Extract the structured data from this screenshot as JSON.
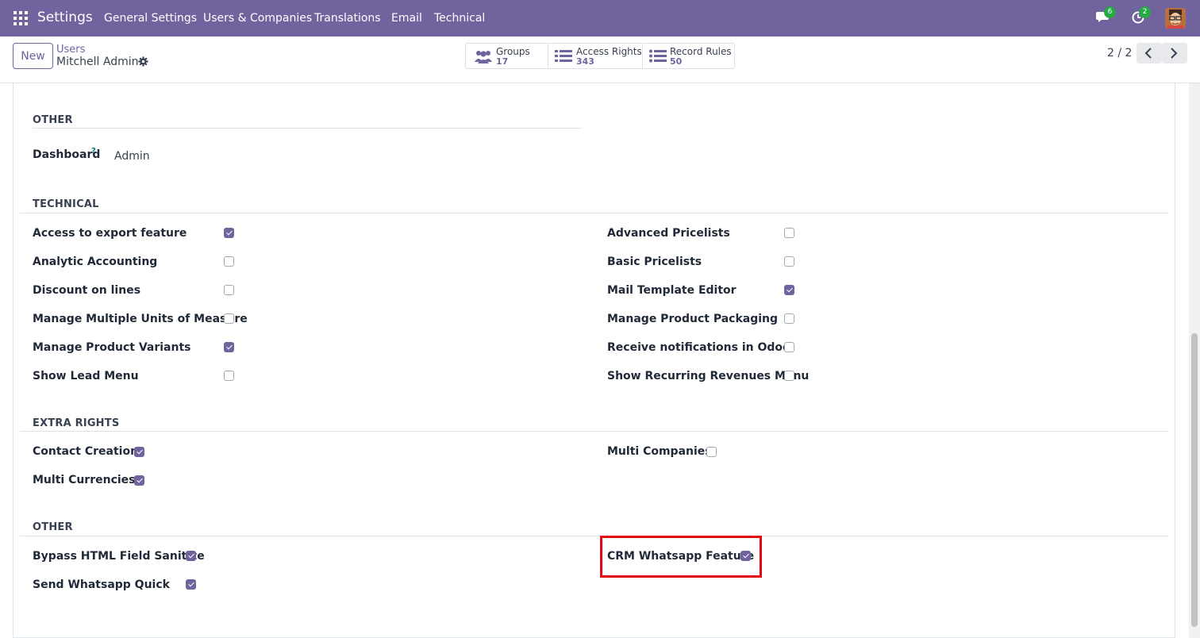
{
  "navbar": {
    "app_name": "Settings",
    "menu": [
      "General Settings",
      "Users & Companies",
      "Translations",
      "Email",
      "Technical"
    ],
    "messages_count": "6",
    "activities_count": "2",
    "bg_color": "#71639e"
  },
  "control_panel": {
    "new_label": "New",
    "breadcrumb": "Users",
    "record_name": "Mitchell Admin",
    "stats": [
      {
        "label": "Groups",
        "value": "17",
        "icon": "users-icon"
      },
      {
        "label": "Access Rights",
        "value": "343",
        "icon": "list-icon"
      },
      {
        "label": "Record Rules",
        "value": "50",
        "icon": "list-icon"
      }
    ],
    "pager": "2 / 2"
  },
  "sections": {
    "other_top": {
      "title": "OTHER",
      "dashboard_label": "Dashboard",
      "dashboard_help": "?",
      "dashboard_value": "Admin"
    },
    "technical": {
      "title": "TECHNICAL",
      "left": [
        {
          "label": "Access to export feature",
          "checked": true
        },
        {
          "label": "Analytic Accounting",
          "checked": false
        },
        {
          "label": "Discount on lines",
          "checked": false
        },
        {
          "label": "Manage Multiple Units of Measure",
          "checked": false
        },
        {
          "label": "Manage Product Variants",
          "checked": true
        },
        {
          "label": "Show Lead Menu",
          "checked": false
        }
      ],
      "right": [
        {
          "label": "Advanced Pricelists",
          "checked": false
        },
        {
          "label": "Basic Pricelists",
          "checked": false
        },
        {
          "label": "Mail Template Editor",
          "checked": true
        },
        {
          "label": "Manage Product Packaging",
          "checked": false
        },
        {
          "label": "Receive notifications in Odoo",
          "checked": false
        },
        {
          "label": "Show Recurring Revenues Menu",
          "checked": false
        }
      ]
    },
    "extra_rights": {
      "title": "EXTRA RIGHTS",
      "left": [
        {
          "label": "Contact Creation",
          "checked": true
        },
        {
          "label": "Multi Currencies",
          "checked": true
        }
      ],
      "right": [
        {
          "label": "Multi Companies",
          "checked": false
        }
      ]
    },
    "other_bottom": {
      "title": "OTHER",
      "left": [
        {
          "label": "Bypass HTML Field Sanitize",
          "checked": true
        },
        {
          "label": "Send Whatsapp Quick",
          "checked": true
        }
      ],
      "right": [
        {
          "label": "CRM Whatsapp Feature",
          "checked": true
        }
      ]
    }
  },
  "highlight_color": "#e30613"
}
